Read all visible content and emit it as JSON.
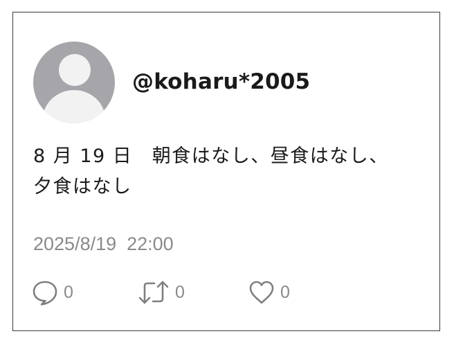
{
  "post": {
    "username": "@koharu*2005",
    "body_line1": "8 月 19 日　朝食はなし、昼食はなし、",
    "body_line2": "夕食はなし",
    "timestamp": "2025/8/19  22:00",
    "actions": {
      "reply_count": "0",
      "repost_count": "0",
      "like_count": "0",
      "reply_icon": "speech-bubble-icon",
      "repost_icon": "repost-arrows-icon",
      "like_icon": "heart-icon"
    }
  },
  "colors": {
    "avatar_bg": "#a6a6aa",
    "avatar_fg": "#f2f2f3",
    "meta_gray": "#8a8a8a",
    "text": "#1a1a1a"
  }
}
